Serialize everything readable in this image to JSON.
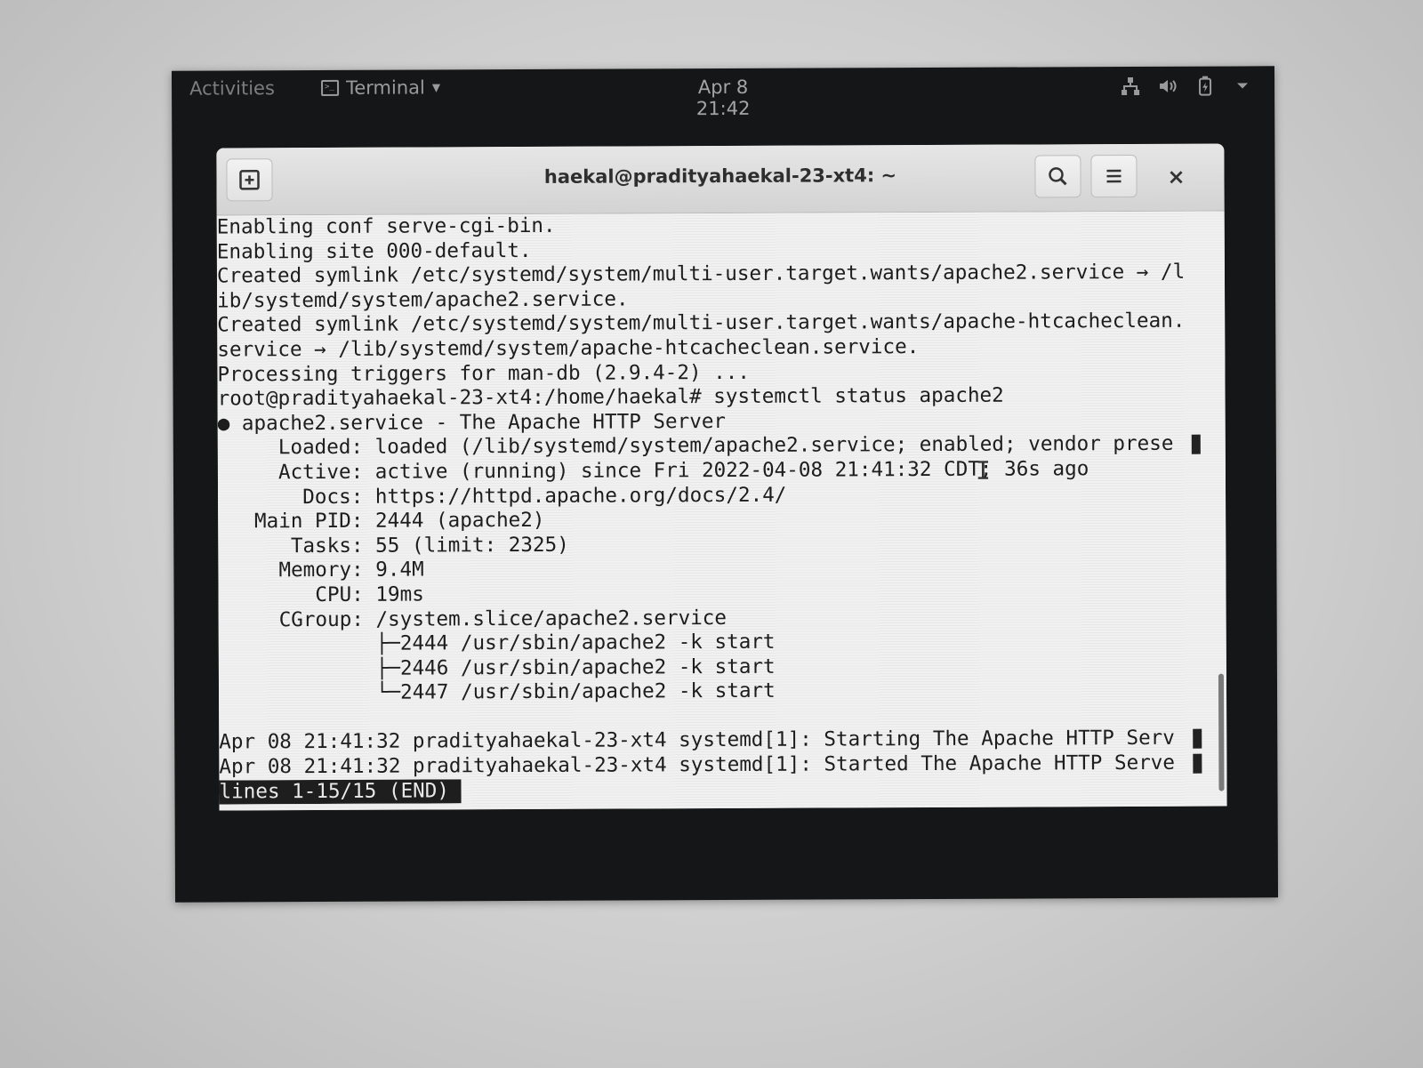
{
  "topbar": {
    "activities": "Activities",
    "app_menu": "Terminal",
    "clock": "Apr 8  21:42",
    "tray_icons": [
      "network-icon",
      "volume-icon",
      "battery-icon",
      "system-menu-caret-icon"
    ]
  },
  "window": {
    "title": "haekal@pradityahaekal-23-xt4: ~",
    "icons": [
      "new-tab-icon",
      "search-icon",
      "menu-icon",
      "close-icon"
    ],
    "close_glyph": "×"
  },
  "terminal": {
    "lines": [
      {
        "text": "Enabling conf serve-cgi-bin.",
        "truncated": false
      },
      {
        "text": "Enabling site 000-default.",
        "truncated": false
      },
      {
        "text": "Created symlink /etc/systemd/system/multi-user.target.wants/apache2.service → /l",
        "truncated": false
      },
      {
        "text": "ib/systemd/system/apache2.service.",
        "truncated": false
      },
      {
        "text": "Created symlink /etc/systemd/system/multi-user.target.wants/apache-htcacheclean.",
        "truncated": false
      },
      {
        "text": "service → /lib/systemd/system/apache-htcacheclean.service.",
        "truncated": false
      },
      {
        "text": "Processing triggers for man-db (2.9.4-2) ...",
        "truncated": false
      },
      {
        "text": "root@pradityahaekal-23-xt4:/home/haekal# systemctl status apache2",
        "truncated": false
      },
      {
        "text": "● apache2.service - The Apache HTTP Server",
        "truncated": false
      },
      {
        "text": "     Loaded: loaded (/lib/systemd/system/apache2.service; enabled; vendor prese",
        "truncated": true
      },
      {
        "text": "     Active: active (running) since Fri 2022-04-08 21:41:32 CDT; 36s ago",
        "truncated": false
      },
      {
        "text": "       Docs: https://httpd.apache.org/docs/2.4/",
        "truncated": false
      },
      {
        "text": "   Main PID: 2444 (apache2)",
        "truncated": false
      },
      {
        "text": "      Tasks: 55 (limit: 2325)",
        "truncated": false
      },
      {
        "text": "     Memory: 9.4M",
        "truncated": false
      },
      {
        "text": "        CPU: 19ms",
        "truncated": false
      },
      {
        "text": "     CGroup: /system.slice/apache2.service",
        "truncated": false
      },
      {
        "text": "             ├─2444 /usr/sbin/apache2 -k start",
        "truncated": false
      },
      {
        "text": "             ├─2446 /usr/sbin/apache2 -k start",
        "truncated": false
      },
      {
        "text": "             └─2447 /usr/sbin/apache2 -k start",
        "truncated": false
      },
      {
        "text": "",
        "truncated": false
      },
      {
        "text": "Apr 08 21:41:32 pradityahaekal-23-xt4 systemd[1]: Starting The Apache HTTP Serv",
        "truncated": true
      },
      {
        "text": "Apr 08 21:41:32 pradityahaekal-23-xt4 systemd[1]: Started The Apache HTTP Serve",
        "truncated": true
      }
    ],
    "status": "lines 1-15/15 (END)"
  }
}
